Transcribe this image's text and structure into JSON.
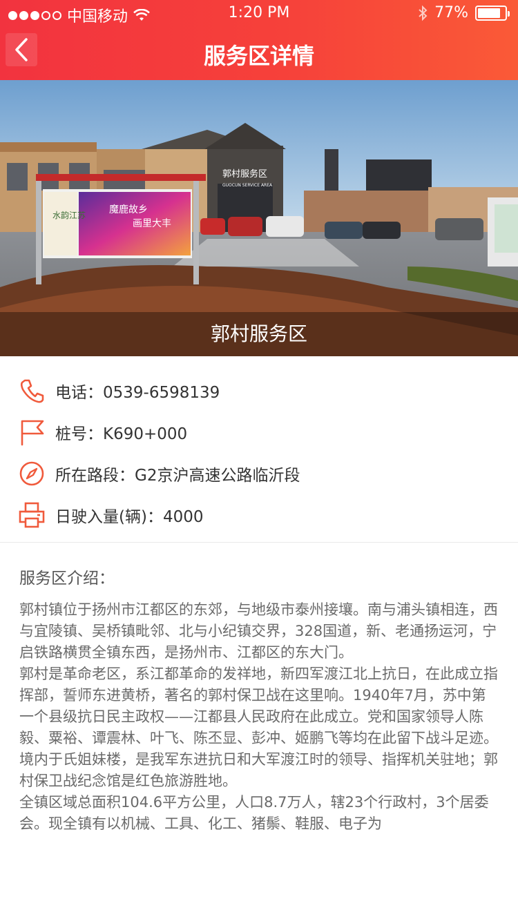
{
  "status_bar": {
    "carrier": "中国移动",
    "time": "1:20 PM",
    "battery": "77%"
  },
  "nav": {
    "title": "服务区详情",
    "back_icon": "chevron-left-icon"
  },
  "hero": {
    "caption": "郭村服务区",
    "sign_text": "郭村服务区",
    "sign_subtext": "GUOCUN SERVICE AREA",
    "billboard_line1": "魔鹿故乡",
    "billboard_line2": "画里大丰",
    "billboard_side": "水韵江苏"
  },
  "info": {
    "phone": "电话：0539-6598139",
    "stake": "桩号：K690+000",
    "section": "所在路段：G2京沪高速公路临沂段",
    "traffic": "日驶入量(辆)：4000",
    "icon_color": "#f05a3c"
  },
  "intro": {
    "title": "服务区介绍：",
    "paragraphs": [
      "郭村镇位于扬州市江都区的东郊，与地级市泰州接壤。南与浦头镇相连，西与宜陵镇、吴桥镇毗邻、北与小纪镇交界，328国道，新、老通扬运河，宁启铁路横贯全镇东西，是扬州市、江都区的东大门。",
      "郭村是革命老区，系江都革命的发祥地，新四军渡江北上抗日，在此成立指挥部，誓师东进黄桥，著名的郭村保卫战在这里响。1940年7月，苏中第一个县级抗日民主政权——江都县人民政府在此成立。党和国家领导人陈毅、粟裕、谭震林、叶飞、陈丕显、彭冲、姬鹏飞等均在此留下战斗足迹。境内于氏姐妹楼，是我军东进抗日和大军渡江时的领导、指挥机关驻地；郭村保卫战纪念馆是红色旅游胜地。",
      "全镇区域总面积104.6平方公里，人口8.7万人，辖23个行政村，3个居委会。现全镇有以机械、工具、化工、猪鬃、鞋服、电子为"
    ]
  }
}
